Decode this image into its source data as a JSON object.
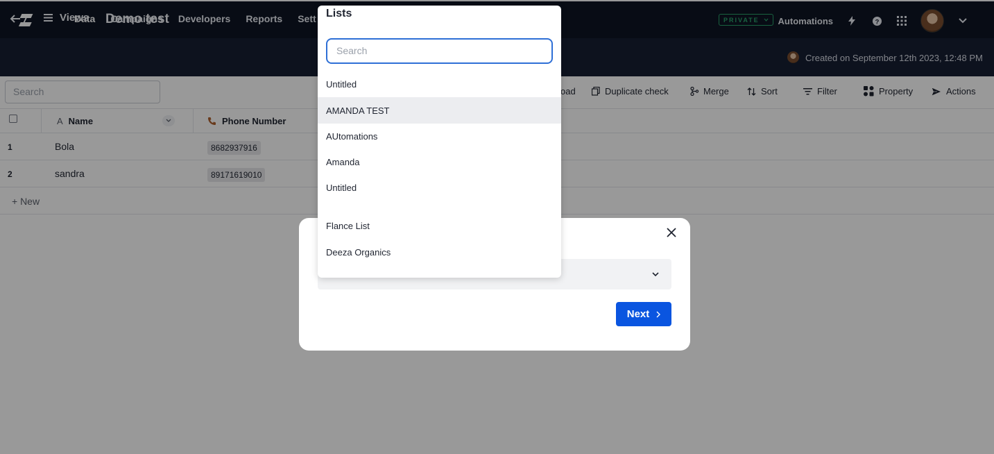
{
  "nav": {
    "items": [
      "Data",
      "Campaigns",
      "Developers",
      "Reports",
      "Sett"
    ],
    "automations": "Automations"
  },
  "subbar": {
    "views_label": "Views",
    "title": "Demo test",
    "badge": "PRIVATE",
    "created": "Created on September 12th 2023, 12:48 PM"
  },
  "toolbar": {
    "search_placeholder": "Search",
    "tools": [
      "oad",
      "Duplicate check",
      "Merge",
      "Sort",
      "Filter",
      "Property",
      "Actions"
    ]
  },
  "table": {
    "headers": [
      "Name",
      "Phone Number"
    ],
    "rows": [
      {
        "num": "1",
        "name": "Bola",
        "phone": "8682937916"
      },
      {
        "num": "2",
        "name": "sandra",
        "phone": "89171619010"
      }
    ],
    "new_label": "+ New"
  },
  "modal": {
    "next_label": "Next"
  },
  "dropdown": {
    "title": "Lists",
    "search_placeholder": "Search",
    "items": [
      "Untitled",
      "AMANDA TEST",
      "AUtomations",
      "Amanda",
      "Untitled",
      "Flance List",
      "Deeza Organics"
    ],
    "highlighted_index": 1
  },
  "colors": {
    "accent": "#0a55e0",
    "nav_bg": "#0e1524",
    "badge_green": "#2aa36b"
  }
}
